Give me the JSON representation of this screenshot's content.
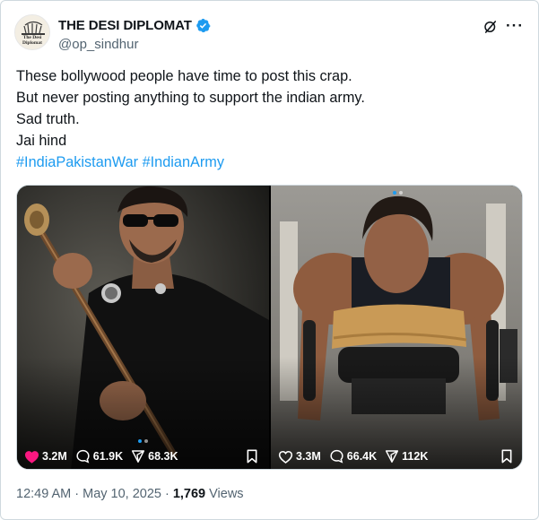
{
  "author": {
    "display_name": "THE DESI DIPLOMAT",
    "handle": "@op_sindhur",
    "avatar_text": "The Desi Diplomat",
    "verified": true,
    "verified_color": "#1d9bf0"
  },
  "header_icons": {
    "grok": "grok-icon",
    "more": "more-icon",
    "more_glyph": "···"
  },
  "tweet": {
    "lines": [
      "These bollywood people have time to post this crap.",
      "But never posting anything to support the indian army.",
      "Sad truth.",
      "Jai hind"
    ],
    "hashtags": [
      "#IndiaPakistanWar",
      "#IndianArmy"
    ]
  },
  "media": [
    {
      "description_icon": "photo",
      "likes": "3.2M",
      "comments": "61.9K",
      "shares": "68.3K",
      "liked": true,
      "like_color": "#f91880"
    },
    {
      "description_icon": "photo",
      "likes": "3.3M",
      "comments": "66.4K",
      "shares": "112K",
      "liked": false
    }
  ],
  "meta": {
    "time": "12:49 AM",
    "separator": "·",
    "date": "May 10, 2025",
    "views_count": "1,769",
    "views_label": "Views"
  },
  "colors": {
    "accent": "#1d9bf0",
    "muted": "#536471",
    "text": "#0f1419"
  }
}
